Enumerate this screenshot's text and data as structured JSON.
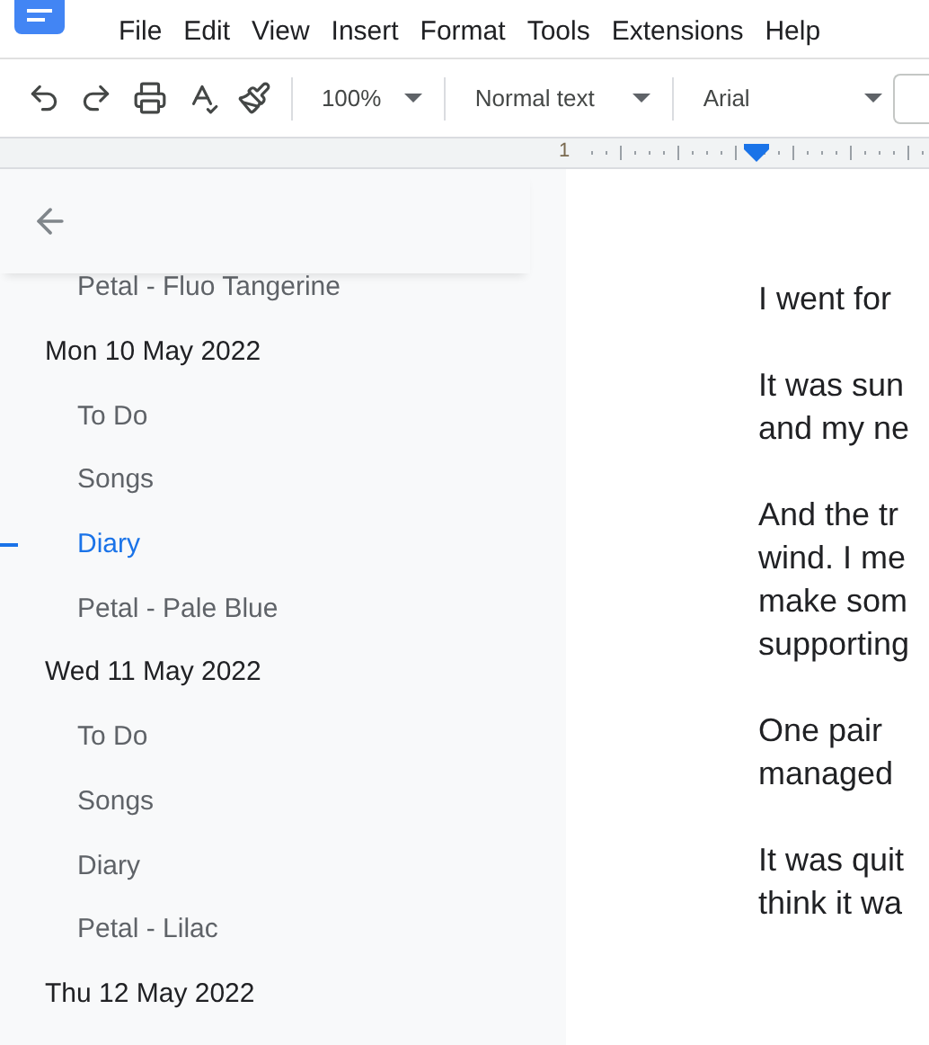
{
  "menu": [
    "File",
    "Edit",
    "View",
    "Insert",
    "Format",
    "Tools",
    "Extensions",
    "Help"
  ],
  "toolbar": {
    "zoom": "100%",
    "style": "Normal text",
    "font": "Arial"
  },
  "ruler": {
    "label": "1"
  },
  "outline": {
    "leading_items": [
      {
        "text": "Petal - Fluo Tangerine",
        "selected": false
      }
    ],
    "headings": [
      {
        "text": "Mon 10 May 2022",
        "children": [
          {
            "text": "To Do",
            "selected": false
          },
          {
            "text": "Songs",
            "selected": false
          },
          {
            "text": "Diary",
            "selected": true
          },
          {
            "text": "Petal - Pale Blue",
            "selected": false
          }
        ]
      },
      {
        "text": "Wed 11 May 2022",
        "children": [
          {
            "text": "To Do",
            "selected": false
          },
          {
            "text": "Songs",
            "selected": false
          },
          {
            "text": "Diary",
            "selected": false
          },
          {
            "text": "Petal - Lilac",
            "selected": false
          }
        ]
      },
      {
        "text": "Thu 12 May 2022"
      }
    ]
  },
  "document": {
    "paragraphs": [
      [
        "I went for"
      ],
      [
        "It was sun",
        "and my ne"
      ],
      [
        "And the tr",
        "wind. I me",
        "make som",
        "supporting"
      ],
      [
        "One pair",
        "managed"
      ],
      [
        "It was quit",
        "think it wa"
      ]
    ]
  }
}
